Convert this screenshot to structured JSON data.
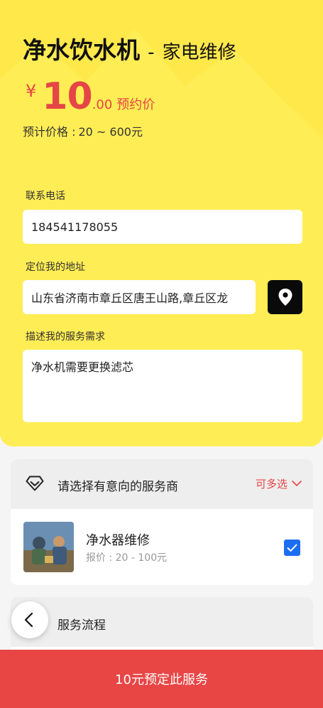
{
  "header": {
    "title": "净水饮水机",
    "separator": "-",
    "subtitle": "家电维修"
  },
  "price": {
    "currency": "¥",
    "integer": "10",
    "decimal": ".00",
    "label": "预约价",
    "range_label": "预计价格 :",
    "range_value": "20 ~ 600元"
  },
  "form": {
    "phone_label": "联系电话",
    "phone_value": "184541178055",
    "address_label": "定位我的地址",
    "address_value": "山东省济南市章丘区唐王山路,章丘区龙",
    "need_label": "描述我的服务需求",
    "need_value": "净水机需要更换滤芯"
  },
  "providers": {
    "header": "请选择有意向的服务商",
    "multi_select": "可多选",
    "items": [
      {
        "name": "净水器维修",
        "price": "报价 : 20 - 100元",
        "checked": true
      }
    ]
  },
  "process": {
    "header": "服务流程"
  },
  "footer": {
    "button": "10元预定此服务"
  },
  "colors": {
    "hero_bg": "#ffe84a",
    "accent": "#e54646",
    "checkbox": "#1d6df0",
    "footer_bg": "#e84545"
  },
  "icons": [
    "location-pin-icon",
    "diamond-icon",
    "chevron-down-icon",
    "checkmark-icon",
    "back-arrow-icon"
  ]
}
